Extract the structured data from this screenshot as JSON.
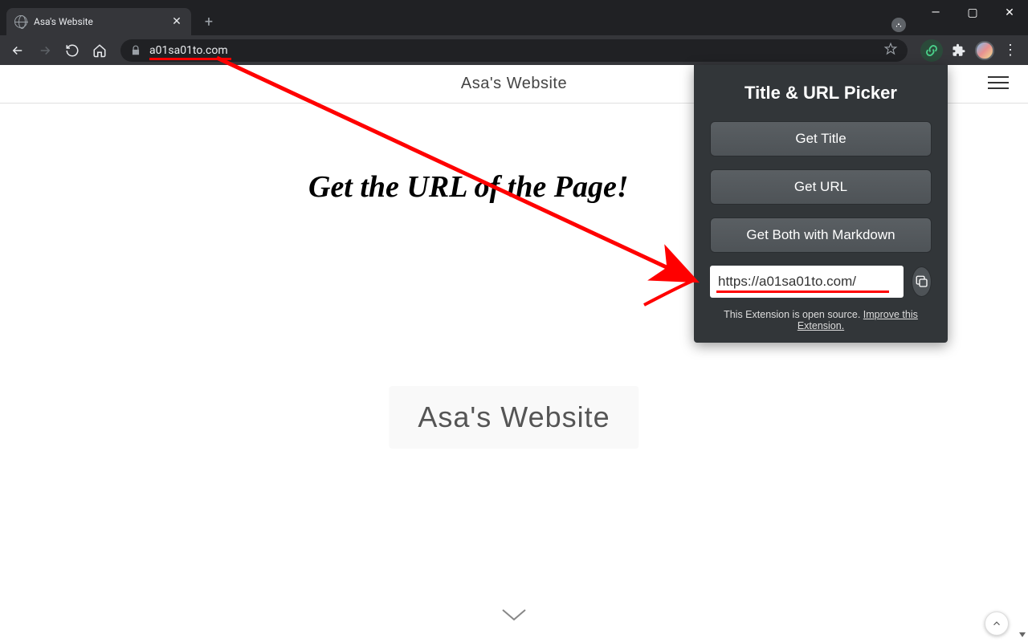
{
  "browser": {
    "tab_title": "Asa's Website",
    "url_display": "a01sa01to.com"
  },
  "page": {
    "header_title": "Asa's Website",
    "hero_title": "Asa's Website"
  },
  "annotation": {
    "text": "Get the URL of the Page!"
  },
  "extension": {
    "title": "Title & URL Picker",
    "btn_get_title": "Get Title",
    "btn_get_url": "Get URL",
    "btn_get_both": "Get Both with Markdown",
    "output_value": "https://a01sa01to.com/",
    "footer_text": "This Extension is open source. ",
    "footer_link": "Improve this Extension."
  }
}
